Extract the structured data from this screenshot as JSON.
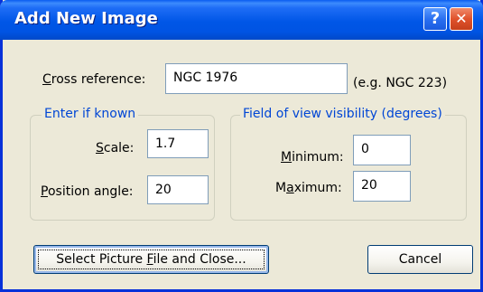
{
  "window": {
    "title": "Add New Image",
    "help_glyph": "?",
    "close_glyph": "✕"
  },
  "cross_reference": {
    "label_prefix": "C",
    "label_rest": "ross reference:",
    "value": "NGC 1976",
    "hint": "(e.g. NGC 223)"
  },
  "enter_if_known": {
    "legend": "Enter if known",
    "scale": {
      "label_prefix": "S",
      "label_rest": "cale:",
      "value": "1.7"
    },
    "position_angle": {
      "label_prefix": "P",
      "label_rest": "osition angle:",
      "value": "20"
    }
  },
  "field_of_view": {
    "legend": "Field of view visibility (degrees)",
    "minimum": {
      "label_prefix": "M",
      "label_rest": "inimum:",
      "value": "0"
    },
    "maximum": {
      "label_a": "M",
      "label_u": "a",
      "label_b": "ximum:",
      "value": "20"
    }
  },
  "buttons": {
    "select_a": "Select Picture ",
    "select_u": "F",
    "select_b": "ile and Close...",
    "cancel": "Cancel"
  },
  "colors": {
    "titlebar": "#0054e3",
    "dialog_bg": "#ece9d8",
    "legend_text": "#0046d5",
    "close_button": "#e0522c"
  }
}
